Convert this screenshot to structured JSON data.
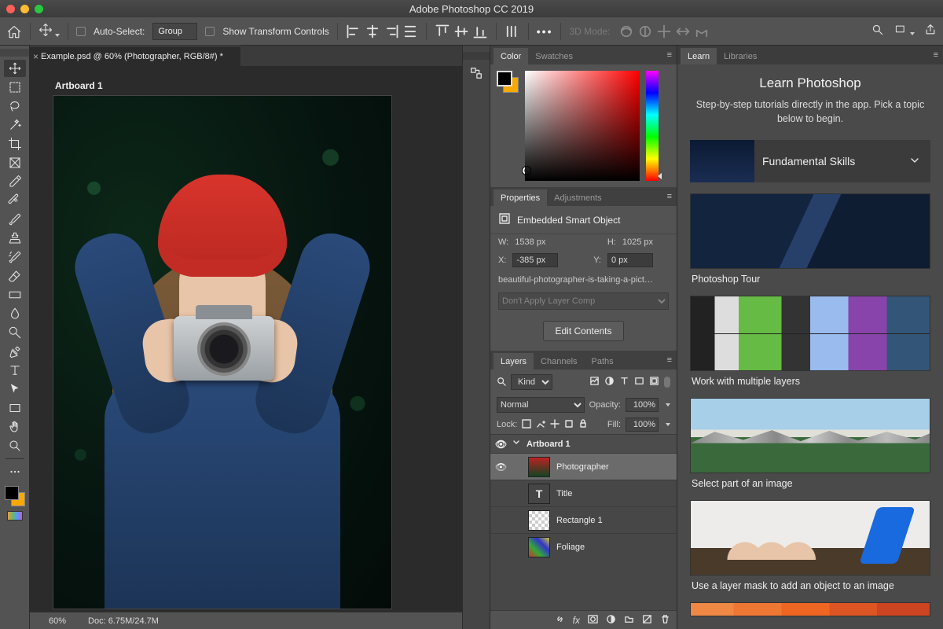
{
  "window": {
    "title": "Adobe Photoshop CC 2019"
  },
  "options": {
    "auto_select_label": "Auto-Select:",
    "auto_select_target": "Group",
    "show_transform_label": "Show Transform Controls",
    "mode3d_label": "3D Mode:"
  },
  "document": {
    "tab_title": "Example.psd @ 60% (Photographer, RGB/8#) *",
    "artboard_label": "Artboard 1",
    "zoom": "60%",
    "doc_size": "Doc: 6.75M/24.7M"
  },
  "panels": {
    "color": {
      "tabs": [
        "Color",
        "Swatches"
      ],
      "active": 0
    },
    "properties": {
      "tabs": [
        "Properties",
        "Adjustments"
      ],
      "active": 0,
      "type_label": "Embedded Smart Object",
      "w_label": "W:",
      "w_value": "1538 px",
      "h_label": "H:",
      "h_value": "1025 px",
      "x_label": "X:",
      "x_value": "-385 px",
      "y_label": "Y:",
      "y_value": "0 px",
      "filename": "beautiful-photographer-is-taking-a-pict…",
      "layer_comp": "Don't Apply Layer Comp",
      "edit_btn": "Edit Contents"
    },
    "layers": {
      "tabs": [
        "Layers",
        "Channels",
        "Paths"
      ],
      "active": 0,
      "filter_label": "Kind",
      "blend_mode": "Normal",
      "opacity_label": "Opacity:",
      "opacity_value": "100%",
      "lock_label": "Lock:",
      "fill_label": "Fill:",
      "fill_value": "100%",
      "items": [
        {
          "name": "Artboard 1",
          "group": true,
          "visible": true
        },
        {
          "name": "Photographer",
          "visible": true,
          "selected": true
        },
        {
          "name": "Title"
        },
        {
          "name": "Rectangle 1"
        },
        {
          "name": "Foliage"
        }
      ]
    }
  },
  "learn": {
    "tabs": [
      "Learn",
      "Libraries"
    ],
    "active": 0,
    "heading": "Learn Photoshop",
    "sub": "Step-by-step tutorials directly in the app. Pick a topic below to begin.",
    "accordion": "Fundamental Skills",
    "tiles": [
      {
        "caption": "Photoshop Tour"
      },
      {
        "caption": "Work with multiple layers"
      },
      {
        "caption": "Select part of an image"
      },
      {
        "caption": "Use a layer mask to add an object to an image"
      }
    ]
  }
}
